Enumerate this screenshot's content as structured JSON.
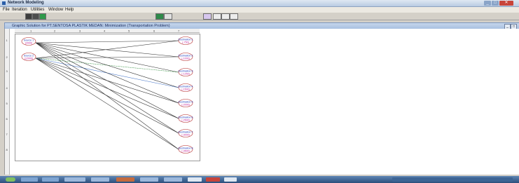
{
  "window": {
    "title": "Network Modeling"
  },
  "menu": [
    "File",
    "Iteration",
    "Utilities",
    "Window",
    "Help"
  ],
  "child_window": {
    "title": "Graphic Solution for PT.SENTOSA PLASTIK MEDAN: Minimization (Transportation Problem)"
  },
  "ruler": {
    "top": [
      "1",
      "2",
      "3",
      "4",
      "5",
      "6",
      "7"
    ],
    "left": [
      "1",
      "2",
      "3",
      "4",
      "5",
      "6",
      "7",
      "8"
    ]
  },
  "sources": [
    {
      "label": "Source 1",
      "value": "(2000)"
    },
    {
      "label": "Source 2",
      "value": "(12000)"
    }
  ],
  "destinations": [
    {
      "label": "Destination 1",
      "value": "(-750)"
    },
    {
      "label": "Destination 2",
      "value": "(-1000)"
    },
    {
      "label": "Destination 3",
      "value": "(-1250)"
    },
    {
      "label": "Destination 4",
      "value": "(-1500)"
    },
    {
      "label": "Destination 5",
      "value": "(-2000)"
    },
    {
      "label": "Destination 6",
      "value": "(-2500)"
    },
    {
      "label": "Destination 7",
      "value": "(-3000)"
    },
    {
      "label": "Destination 8",
      "value": "(-3500)"
    }
  ],
  "colors": {
    "node_outline": "#b22222",
    "node_text": "#1f3fbf",
    "value_text": "#c0209a",
    "edge": "#333333",
    "edge_green": "#2e8b3a",
    "edge_blue": "#4a78c8"
  }
}
